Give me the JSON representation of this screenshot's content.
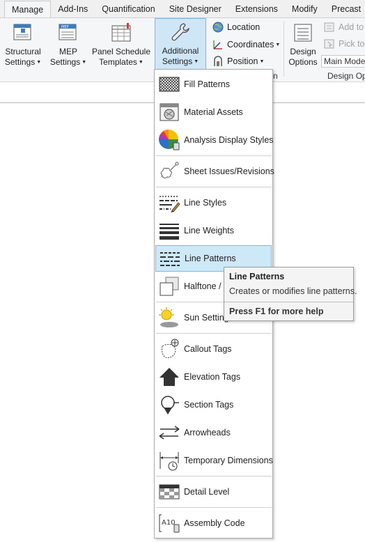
{
  "tabs": [
    "Manage",
    "Add-Ins",
    "Quantification",
    "Site Designer",
    "Extensions",
    "Modify",
    "Precast"
  ],
  "ribbon": {
    "structural_settings": "Structural\nSettings",
    "mep_settings": "MEP\nSettings",
    "panel_schedule_templates": "Panel Schedule\nTemplates",
    "additional_settings": "Additional\nSettings",
    "location": "Location",
    "coordinates": "Coordinates",
    "position": "Position",
    "design_options": "Design\nOptions",
    "add_to": "Add to",
    "pick_to": "Pick to",
    "main_model": "Main Model",
    "panel_label_partial": "n",
    "design_options_panel": "Design Op"
  },
  "menu": {
    "items": [
      {
        "label": "Fill Patterns",
        "icon": "fill-patterns-icon"
      },
      {
        "label": "Material Assets",
        "icon": "material-assets-icon"
      },
      {
        "label": "Analysis Display Styles",
        "icon": "analysis-display-styles-icon"
      },
      {
        "label": "Sheet Issues/Revisions",
        "icon": "sheet-issues-revisions-icon"
      },
      {
        "label": "Line Styles",
        "icon": "line-styles-icon"
      },
      {
        "label": "Line Weights",
        "icon": "line-weights-icon"
      },
      {
        "label": "Line Patterns",
        "icon": "line-patterns-icon"
      },
      {
        "label": "Halftone / U",
        "icon": "halftone-underlay-icon"
      },
      {
        "label": "Sun Setting",
        "icon": "sun-settings-icon"
      },
      {
        "label": "Callout Tags",
        "icon": "callout-tags-icon"
      },
      {
        "label": "Elevation Tags",
        "icon": "elevation-tags-icon"
      },
      {
        "label": "Section Tags",
        "icon": "section-tags-icon"
      },
      {
        "label": "Arrowheads",
        "icon": "arrowheads-icon"
      },
      {
        "label": "Temporary Dimensions",
        "icon": "temporary-dimensions-icon"
      },
      {
        "label": "Detail Level",
        "icon": "detail-level-icon"
      },
      {
        "label": "Assembly Code",
        "icon": "assembly-code-icon"
      }
    ],
    "highlighted": "Line Patterns"
  },
  "tooltip": {
    "title": "Line Patterns",
    "description": "Creates or modifies line patterns.",
    "help": "Press F1 for more help"
  },
  "colors": {
    "highlight_bg": "#cde8f7",
    "highlight_border": "#7fb7e2",
    "accent_blue": "#2a6fb0"
  }
}
